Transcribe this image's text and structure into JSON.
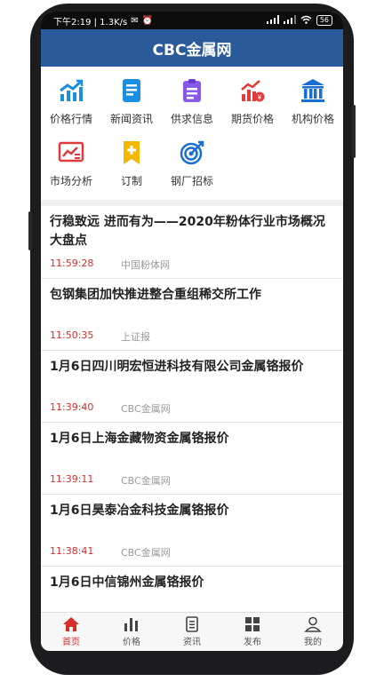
{
  "status_bar": {
    "time_speed": "下午2:19 | 1.3K/s",
    "battery": "56"
  },
  "app": {
    "title": "CBC金属网"
  },
  "grid": [
    {
      "label": "价格行情",
      "icon": "trend-chart-icon"
    },
    {
      "label": "新闻资讯",
      "icon": "news-document-icon"
    },
    {
      "label": "供求信息",
      "icon": "clipboard-icon"
    },
    {
      "label": "期货价格",
      "icon": "futures-bar-chart-icon"
    },
    {
      "label": "机构价格",
      "icon": "institution-building-icon"
    },
    {
      "label": "市场分析",
      "icon": "analysis-chart-icon"
    },
    {
      "label": "订制",
      "icon": "bookmark-plus-icon"
    },
    {
      "label": "钢厂招标",
      "icon": "target-icon"
    }
  ],
  "news": [
    {
      "title": "行稳致远 进而有为——2020年粉体行业市场概况大盘点",
      "time": "11:59:28",
      "source": "中国粉体网"
    },
    {
      "title": "包钢集团加快推进整合重组稀交所工作",
      "time": "11:50:35",
      "source": "上证报"
    },
    {
      "title": "1月6日四川明宏恒进科技有限公司金属铬报价",
      "time": "11:39:40",
      "source": "CBC金属网"
    },
    {
      "title": "1月6日上海金藏物资金属铬报价",
      "time": "11:39:11",
      "source": "CBC金属网"
    },
    {
      "title": "1月6日昊泰冶金科技金属铬报价",
      "time": "11:38:41",
      "source": "CBC金属网"
    },
    {
      "title": "1月6日中信锦州金属铬报价",
      "time": "",
      "source": ""
    }
  ],
  "tabs": [
    {
      "label": "首页",
      "icon": "home-icon",
      "active": true
    },
    {
      "label": "价格",
      "icon": "bar-chart-icon",
      "active": false
    },
    {
      "label": "资讯",
      "icon": "document-icon",
      "active": false
    },
    {
      "label": "发布",
      "icon": "grid-icon",
      "active": false
    },
    {
      "label": "我的",
      "icon": "person-icon",
      "active": false
    }
  ],
  "colors": {
    "header": "#2a5a9a",
    "accent_red": "#d62d2d",
    "icon_blue": "#1a8fe0",
    "icon_purple": "#8a5ae6",
    "icon_yellow": "#f5b800"
  }
}
